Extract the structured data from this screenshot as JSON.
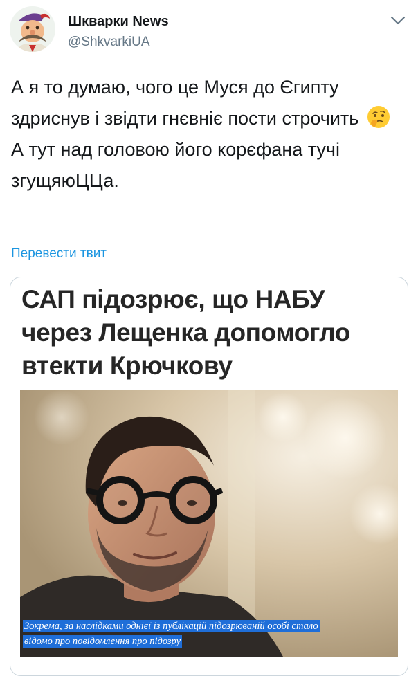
{
  "header": {
    "display_name": "Шкварки News",
    "handle": "@ShkvarkiUA",
    "avatar_icon": "cossack-avatar-icon",
    "menu_icon": "chevron-down-icon"
  },
  "tweet": {
    "text_before_emoji": "А я то думаю, чого це Муся до Єгипту здриснув і звідти гнєвніє пости строчить",
    "emoji_icon": "thinking-face-emoji",
    "text_after_emoji": "А тут над головою його корєфана тучі згущяюЦЦа.",
    "translate_label": "Перевести твит"
  },
  "card": {
    "headline": "САП підозрює, що НАБУ через Лещенка допомогло втекти Крючкову",
    "caption": "Зокрема, за наслідками однієї із публікацій підозрюваній особі стало відомо про повідомлення про підозру"
  },
  "colors": {
    "link": "#1b95e0",
    "secondary_text": "#657786",
    "caption_highlight": "#1f6ed8",
    "border": "#ccd6dd"
  }
}
